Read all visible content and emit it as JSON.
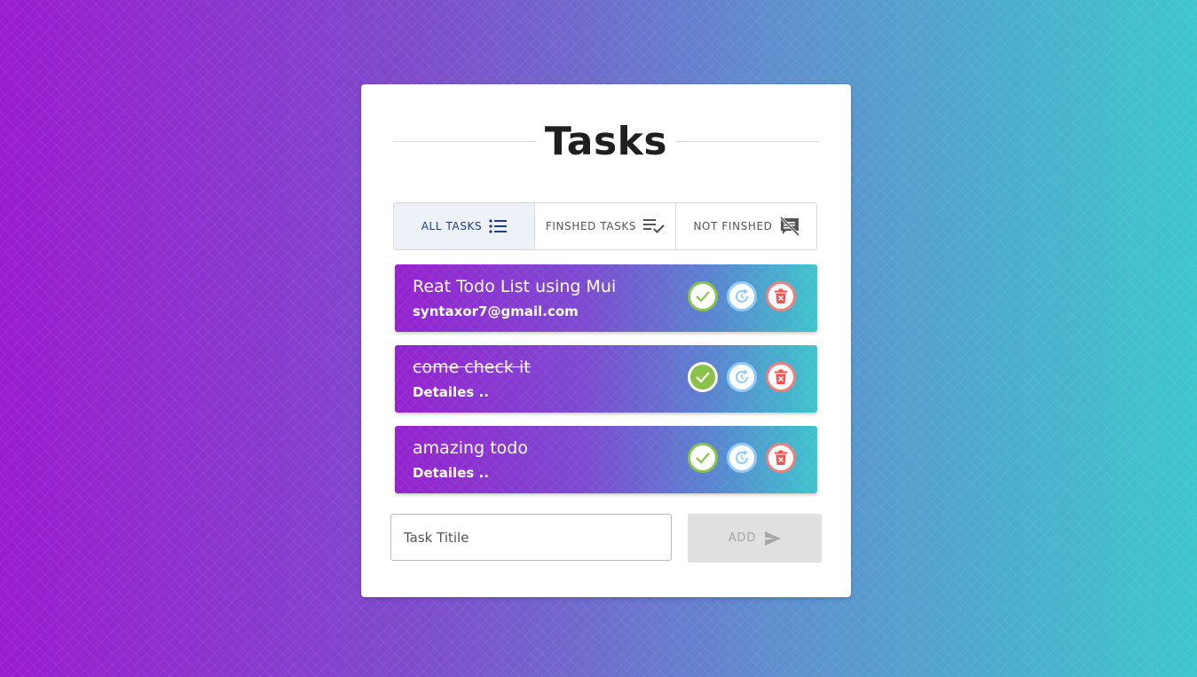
{
  "page": {
    "title": "Tasks"
  },
  "tabs": [
    {
      "label": "ALL TASKS",
      "icon": "list-icon",
      "active": true
    },
    {
      "label": "FINSHED TASKS",
      "icon": "playlist-check-icon",
      "active": false
    },
    {
      "label": "NOT FINSHED",
      "icon": "comment-off-icon",
      "active": false
    }
  ],
  "tasks": [
    {
      "title": "Reat Todo List using Mui",
      "details": "syntaxor7@gmail.com",
      "completed": false
    },
    {
      "title": "come check it",
      "details": "Detailes ..",
      "completed": true
    },
    {
      "title": "amazing todo",
      "details": "Detailes ..",
      "completed": false
    }
  ],
  "form": {
    "placeholder": "Task Titile",
    "value": "",
    "add_label": "ADD",
    "add_disabled": true
  },
  "colors": {
    "check": "#8bc34a",
    "edit": "#90caf9",
    "delete": "#ef5350",
    "active_tab_text": "#1e3a8a",
    "active_tab_bg": "#edf2f8"
  }
}
